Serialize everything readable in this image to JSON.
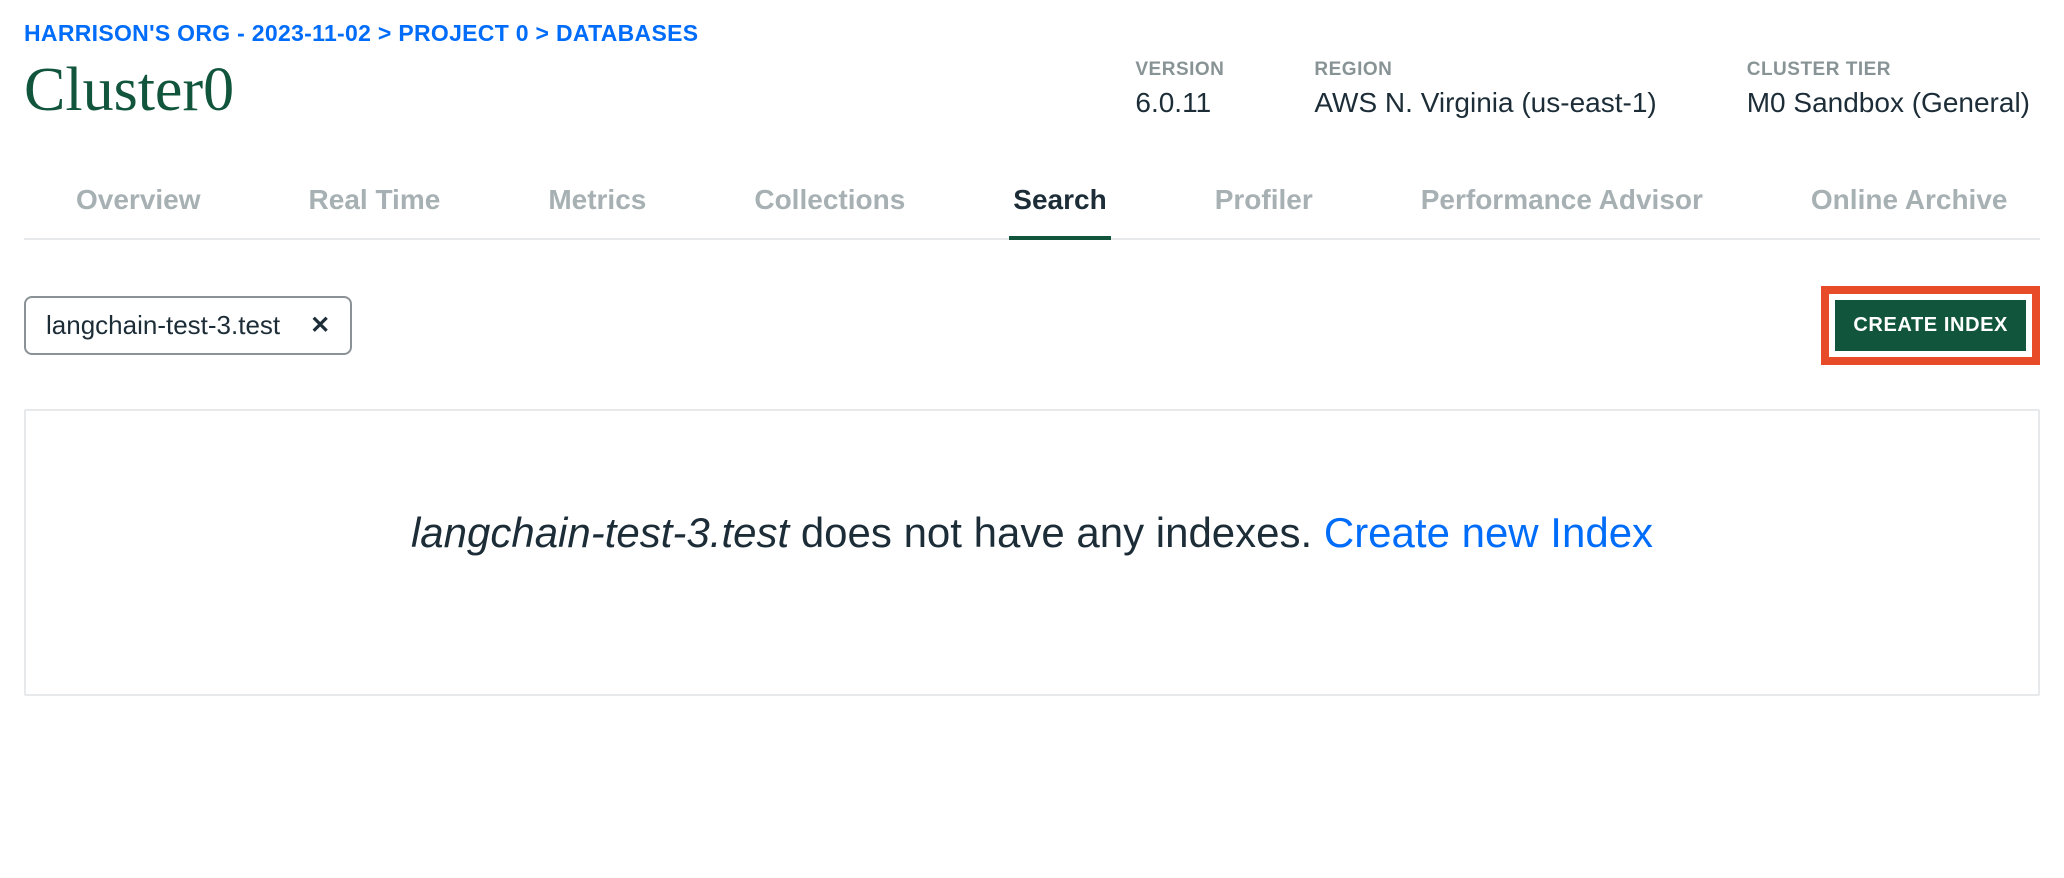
{
  "breadcrumb": {
    "org": "HARRISON'S ORG - 2023-11-02",
    "project": "PROJECT 0",
    "section": "DATABASES",
    "sep": ">"
  },
  "cluster": {
    "name": "Cluster0"
  },
  "meta": {
    "version": {
      "label": "VERSION",
      "value": "6.0.11"
    },
    "region": {
      "label": "REGION",
      "value": "AWS N. Virginia (us-east-1)"
    },
    "tier": {
      "label": "CLUSTER TIER",
      "value": "M0 Sandbox (General)"
    }
  },
  "tabs": {
    "overview": "Overview",
    "realtime": "Real Time",
    "metrics": "Metrics",
    "collections": "Collections",
    "search": "Search",
    "profiler": "Profiler",
    "advisor": "Performance Advisor",
    "archive": "Online Archive"
  },
  "filter": {
    "chip": "langchain-test-3.test"
  },
  "actions": {
    "create_index": "CREATE INDEX"
  },
  "empty": {
    "collection": "langchain-test-3.test",
    "message": " does not have any indexes. ",
    "link": "Create new Index"
  }
}
